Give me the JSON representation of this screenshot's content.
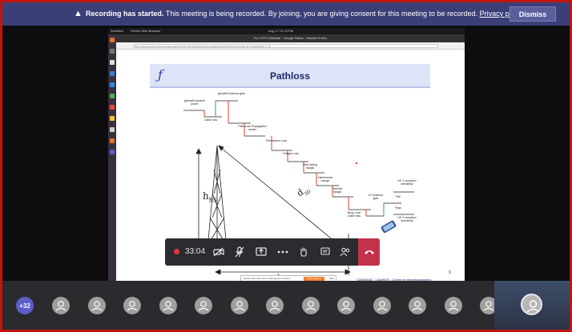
{
  "banner": {
    "bold": "Recording has started.",
    "message": " This meeting is being recorded. By joining, you are giving consent for this meeting to be recorded. ",
    "link": "Privacy policy",
    "dismiss": "Dismiss"
  },
  "shared_screen": {
    "topbar_left": "Activities",
    "topbar_app": "Firefox Web Browser",
    "topbar_clock": "Aug 17  12:19 PM",
    "window_title": "For OTFS-Website - Google Slides - Mozilla Firefox",
    "url": "https://docs.google.com/presentation/d/1d7bs3dYh6sU6eZbxqOr6v2usmN8o0FgjeobOxM/present?slide=id.g7ae0b09e0d_0_31"
  },
  "slide": {
    "title": "Pathloss",
    "logo": "ƒ",
    "labels": {
      "gnb_power": "gNodeB transmit power",
      "gnb_gain": "gNodeB Antenna gain",
      "cable_loss": "Cable loss",
      "path_loss": "Path Loss Propagation model",
      "penetration": "Penetration Loss",
      "foliage": "Foliage Loss",
      "slow_fading": "Slow fading margin",
      "interference": "Interference margin",
      "rain": "Rain/Ice margin",
      "ut_gain": "UT Antenna gain",
      "body_loss": "Body Loss Cable loss",
      "ue1": "UE 1 reception sensitivity",
      "fail": "Fail",
      "pass": "Pass",
      "ue2": "UE 2 reception sensitivity"
    },
    "h_bs": "h",
    "h_bs_sub": "BS",
    "d3d": "d",
    "d3d_sub": "3D",
    "d2d": "d",
    "d2d_sub": "2D",
    "footer": "CAMARAD - CAMEER - Centre for electromagnetics",
    "page": "9"
  },
  "share_notice": {
    "text": "teams.microsoft.com is sharing your screen.",
    "stop": "Stop sharing",
    "hide": "Hide"
  },
  "controls": {
    "timer": "33:04"
  },
  "participants": {
    "more": "+32",
    "count": 13
  },
  "colors": {
    "banner": "#3b3f78",
    "accent": "#5b5fc7",
    "hangup": "#c4314b",
    "border": "#c0150e"
  }
}
